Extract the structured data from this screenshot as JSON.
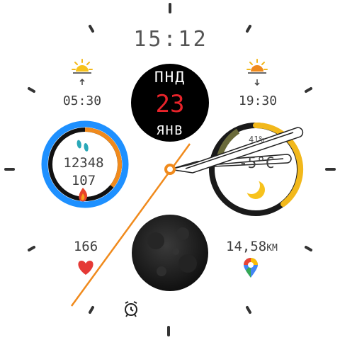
{
  "time": "15:12",
  "date": {
    "weekday": "ПНД",
    "day": "23",
    "month": "ЯНВ"
  },
  "sunrise": {
    "time": "05:30",
    "icon": "sunrise-icon"
  },
  "sunset": {
    "time": "19:30",
    "icon": "sunset-icon"
  },
  "activity": {
    "steps": "12348",
    "calories": "107",
    "steps_progress": 1.0,
    "calories_progress": 0.55,
    "steps_icon": "footprints-icon",
    "calories_icon": "flame-icon"
  },
  "weather": {
    "temperature": "-5°C",
    "humidity": "41%",
    "icon": "moon-icon",
    "progress": 0.6
  },
  "heart_rate": {
    "value": "166",
    "icon": "heart-icon"
  },
  "distance": {
    "value": "14,58",
    "unit": "KM",
    "icon": "maps-pin-icon"
  },
  "alarm": {
    "icon": "alarm-clock-icon"
  },
  "moon_phase": {
    "icon": "moon-phase-icon"
  },
  "colors": {
    "steps_ring": "#1E90FF",
    "calories_ring": "#F08A1C",
    "weather_ring": "#F2B81B",
    "date_day": "#E8232A",
    "seconds_hand": "#F08A1C",
    "heart": "#E53935"
  }
}
